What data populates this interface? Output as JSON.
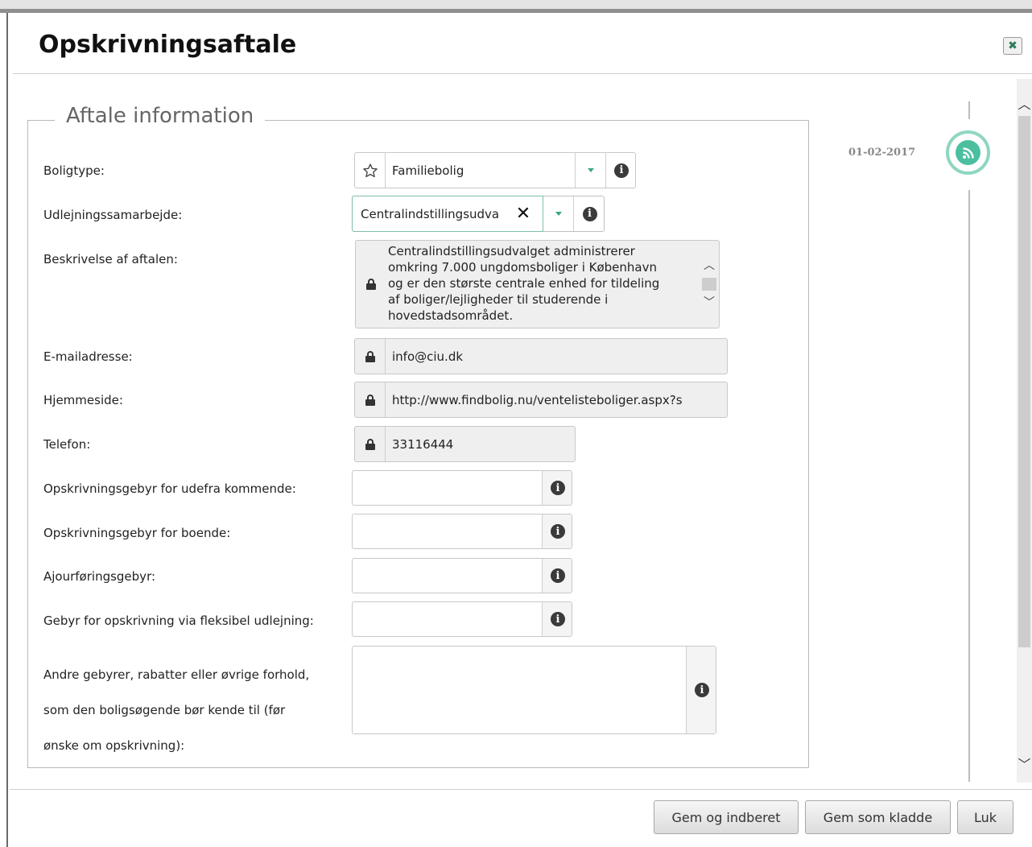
{
  "dialog": {
    "title": "Opskrivningsaftale",
    "close_icon": "close-icon"
  },
  "section": {
    "legend": "Aftale information"
  },
  "fields": {
    "boligtype": {
      "label": "Boligtype:",
      "value": "Familiebolig"
    },
    "udlejningssamarbejde": {
      "label": "Udlejningssamarbejde:",
      "value": "Centralindstillingsudva"
    },
    "beskrivelse": {
      "label": "Beskrivelse af aftalen:",
      "lines": [
        "Centralindstillingsudvalget administrerer",
        "omkring 7.000 ungdomsboliger i København",
        "og er den største centrale enhed for tildeling",
        "af boliger/lejligheder til studerende i",
        "hovedstadsområdet."
      ]
    },
    "email": {
      "label": "E-mailadresse:",
      "value": "info@ciu.dk"
    },
    "hjemmeside": {
      "label": "Hjemmeside:",
      "value": "http://www.findbolig.nu/ventelisteboliger.aspx?s"
    },
    "telefon": {
      "label": "Telefon:",
      "value": "33116444"
    },
    "gebyr_udefra": {
      "label": "Opskrivningsgebyr for udefra kommende:",
      "value": ""
    },
    "gebyr_boende": {
      "label": "Opskrivningsgebyr for boende:",
      "value": ""
    },
    "ajourfoering": {
      "label": "Ajourføringsgebyr:",
      "value": ""
    },
    "gebyr_fleksibel": {
      "label": "Gebyr for opskrivning via fleksibel udlejning:",
      "value": ""
    },
    "andre": {
      "label_lines": [
        "Andre gebyrer, rabatter eller øvrige forhold,",
        "som den boligsøgende bør kende til (før",
        "ønske om opskrivning):"
      ],
      "value": ""
    }
  },
  "timeline": {
    "date": "01-02-2017"
  },
  "footer": {
    "submit_label": "Gem og indberet",
    "draft_label": "Gem som kladde",
    "close_label": "Luk"
  },
  "colors": {
    "accent": "#4cbfa1",
    "accent_light": "#8fd6c2",
    "caret": "#3aa87a"
  }
}
